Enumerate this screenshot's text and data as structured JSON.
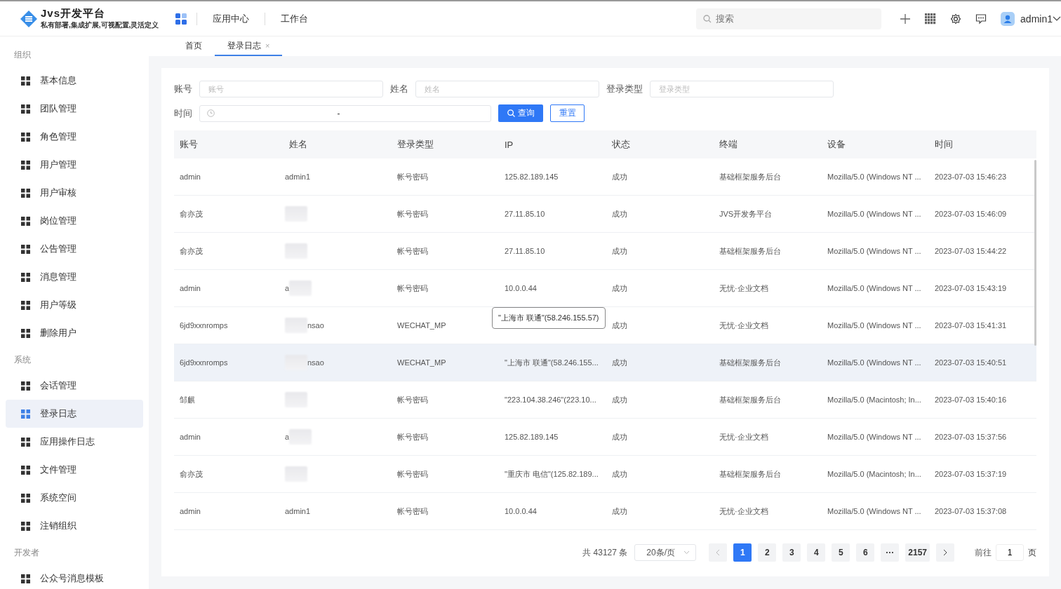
{
  "header": {
    "logo_title": "Jvs开发平台",
    "logo_subtitle": "私有部署,集成扩展,可视配置,灵活定义",
    "nav": [
      "应用中心",
      "工作台"
    ],
    "search": {
      "placeholder": "搜索"
    },
    "user": "admin1"
  },
  "sidebar": {
    "groups": [
      {
        "label": "组织",
        "items": [
          {
            "label": "基本信息",
            "selected": false
          },
          {
            "label": "团队管理",
            "selected": false
          },
          {
            "label": "角色管理",
            "selected": false
          },
          {
            "label": "用户管理",
            "selected": false
          },
          {
            "label": "用户审核",
            "selected": false
          },
          {
            "label": "岗位管理",
            "selected": false
          },
          {
            "label": "公告管理",
            "selected": false
          },
          {
            "label": "消息管理",
            "selected": false
          },
          {
            "label": "用户等级",
            "selected": false
          },
          {
            "label": "删除用户",
            "selected": false
          }
        ]
      },
      {
        "label": "系统",
        "items": [
          {
            "label": "会话管理",
            "selected": false
          },
          {
            "label": "登录日志",
            "selected": true
          },
          {
            "label": "应用操作日志",
            "selected": false
          },
          {
            "label": "文件管理",
            "selected": false
          },
          {
            "label": "系统空间",
            "selected": false
          },
          {
            "label": "注销组织",
            "selected": false
          }
        ]
      },
      {
        "label": "开发者",
        "items": [
          {
            "label": "公众号消息模板",
            "selected": false
          }
        ]
      }
    ]
  },
  "tabs": [
    {
      "label": "首页",
      "selected": false
    },
    {
      "label": "登录日志",
      "selected": true,
      "close": "×"
    }
  ],
  "filters": [
    {
      "label": "账号",
      "placeholder": "账号"
    },
    {
      "label": "姓名",
      "placeholder": "姓名"
    },
    {
      "label": "登录类型",
      "placeholder": "登录类型"
    }
  ],
  "time_filter": {
    "label": "时间",
    "separator": "-"
  },
  "buttons": {
    "search": "查询",
    "reset": "重置"
  },
  "table": {
    "columns": [
      "账号",
      "姓名",
      "登录类型",
      "IP",
      "状态",
      "终端",
      "设备",
      "时间"
    ],
    "rows": [
      {
        "account": "admin",
        "name": "admin1",
        "blurred": false,
        "type": "帐号密码",
        "ip": "125.82.189.145",
        "status": "成功",
        "terminal": "基础框架服务后台",
        "device": "Mozilla/5.0 (Windows NT ...",
        "time": "2023-07-03 15:46:23",
        "highlighted": false
      },
      {
        "account": "俞亦茂",
        "blurred": true,
        "type": "帐号密码",
        "ip": "27.11.85.10",
        "status": "成功",
        "terminal": "JVS开发务平台",
        "device": "Mozilla/5.0 (Windows NT ...",
        "time": "2023-07-03 15:46:09",
        "highlighted": false
      },
      {
        "account": "俞亦茂",
        "blurred": true,
        "type": "帐号密码",
        "ip": "27.11.85.10",
        "status": "成功",
        "terminal": "基础框架服务后台",
        "device": "Mozilla/5.0 (Windows NT ...",
        "time": "2023-07-03 15:44:22",
        "highlighted": false
      },
      {
        "account": "admin",
        "name": "a",
        "blurred": true,
        "type": "帐号密码",
        "ip": "10.0.0.44",
        "status": "成功",
        "terminal": "无忧·企业文档",
        "device": "Mozilla/5.0 (Windows NT ...",
        "time": "2023-07-03 15:43:19",
        "highlighted": false
      },
      {
        "account": "6jd9xxnromps",
        "name_tail": "nsao",
        "blurred": true,
        "type": "WECHAT_MP",
        "tooltip": "\"上海市 联通\"(58.246.155.57)",
        "status": "成功",
        "terminal": "无忧·企业文档",
        "device": "Mozilla/5.0 (Windows NT ...",
        "time": "2023-07-03 15:41:31",
        "highlighted": false
      },
      {
        "account": "6jd9xxnromps",
        "name_tail": "nsao",
        "blurred": true,
        "type": "WECHAT_MP",
        "ip": "\"上海市 联通\"(58.246.155...",
        "status": "成功",
        "terminal": "基础框架服务后台",
        "device": "Mozilla/5.0 (Windows NT ...",
        "time": "2023-07-03 15:40:51",
        "highlighted": true
      },
      {
        "account": "邹麒",
        "blurred": true,
        "type": "帐号密码",
        "ip": "\"223.104.38.246\"(223.10...",
        "status": "成功",
        "terminal": "基础框架服务后台",
        "device": "Mozilla/5.0 (Macintosh; In...",
        "time": "2023-07-03 15:40:16",
        "highlighted": false
      },
      {
        "account": "admin",
        "name": "a",
        "blurred": true,
        "type": "帐号密码",
        "ip": "125.82.189.145",
        "status": "成功",
        "terminal": "无忧·企业文档",
        "device": "Mozilla/5.0 (Windows NT ...",
        "time": "2023-07-03 15:37:56",
        "highlighted": false
      },
      {
        "account": "俞亦茂",
        "blurred": true,
        "type": "帐号密码",
        "ip": "\"重庆市 电信\"(125.82.189...",
        "status": "成功",
        "terminal": "基础框架服务后台",
        "device": "Mozilla/5.0 (Macintosh; In...",
        "time": "2023-07-03 15:37:19",
        "highlighted": false
      },
      {
        "account": "admin",
        "name": "admin1",
        "blurred": false,
        "type": "帐号密码",
        "ip": "10.0.0.44",
        "status": "成功",
        "terminal": "无忧·企业文档",
        "device": "Mozilla/5.0 (Windows NT ...",
        "time": "2023-07-03 15:37:08",
        "highlighted": false
      }
    ]
  },
  "pagination": {
    "total": "共 43127 条",
    "page_size": "20条/页",
    "pages": [
      {
        "label": "1",
        "selected": true
      },
      {
        "label": "2",
        "selected": false
      },
      {
        "label": "3",
        "selected": false
      },
      {
        "label": "4",
        "selected": false
      },
      {
        "label": "5",
        "selected": false
      },
      {
        "label": "6",
        "selected": false
      },
      {
        "label": "···",
        "selected": false
      },
      {
        "label": "2157",
        "selected": false
      }
    ],
    "goto_label": "前往",
    "goto_value": "1",
    "goto_unit": "页"
  }
}
